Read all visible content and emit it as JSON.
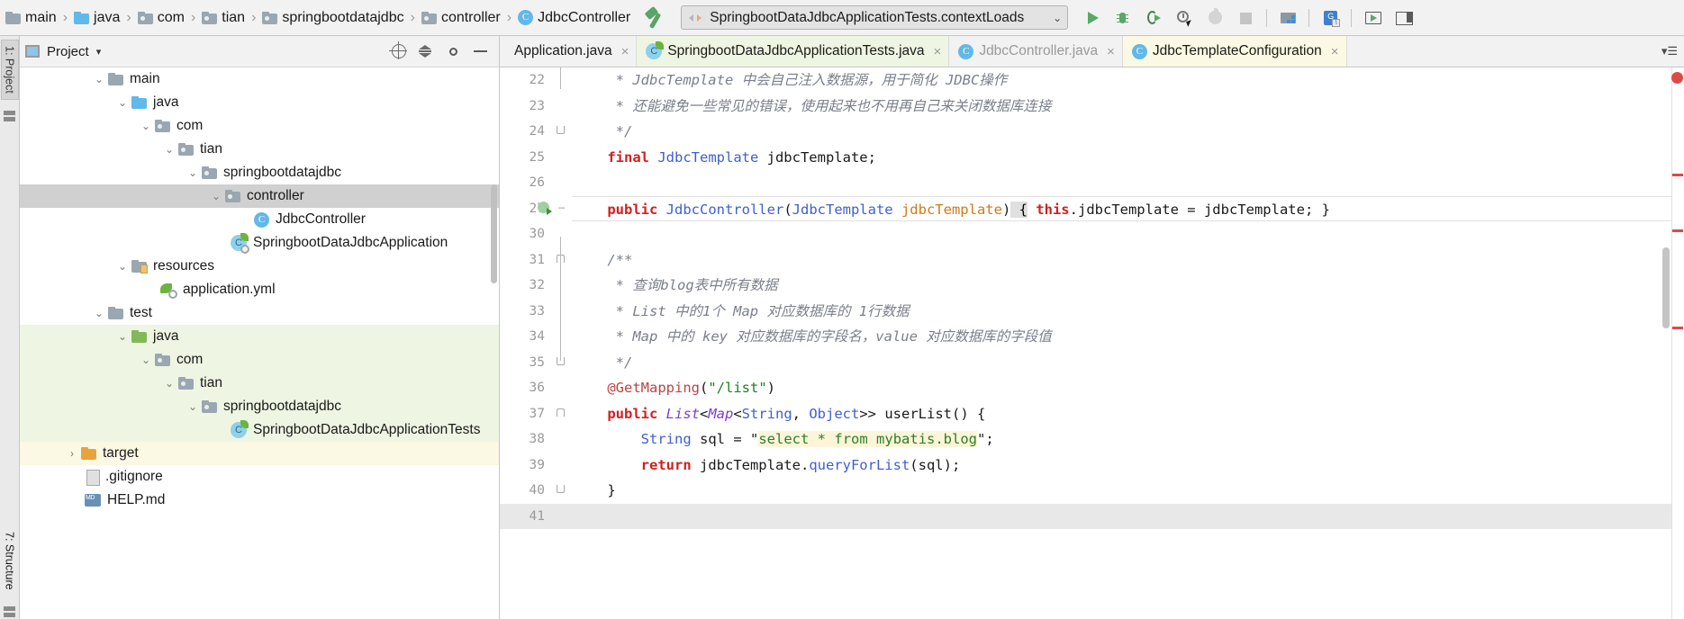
{
  "navbar": {
    "breadcrumb": [
      {
        "label": "main",
        "icon": "folder-icon"
      },
      {
        "label": "java",
        "icon": "folder-blue-icon"
      },
      {
        "label": "com",
        "icon": "package-icon"
      },
      {
        "label": "tian",
        "icon": "package-icon"
      },
      {
        "label": "springbootdatajdbc",
        "icon": "package-icon"
      },
      {
        "label": "controller",
        "icon": "package-icon"
      },
      {
        "label": "JdbcController",
        "icon": "java-class-icon"
      }
    ],
    "separator": "›",
    "build_icon": "hammer-icon",
    "run_config": {
      "name": "SpringbootDataJdbcApplicationTests.contextLoads",
      "chevron": "⌄",
      "icon": "run-config-icon"
    },
    "toolbar_buttons": [
      {
        "name": "run-button",
        "icon": "play-icon",
        "tooltip": "Run"
      },
      {
        "name": "debug-button",
        "icon": "bug-icon",
        "tooltip": "Debug"
      },
      {
        "name": "run-with-coverage-button",
        "icon": "coverage-icon",
        "tooltip": "Run with Coverage"
      },
      {
        "name": "profile-button",
        "icon": "profiler-icon",
        "tooltip": "Profile"
      },
      {
        "name": "attach-button",
        "icon": "apple-icon",
        "tooltip": "Attach"
      },
      {
        "name": "stop-button",
        "icon": "stop-icon",
        "tooltip": "Stop"
      },
      {
        "name": "stack-button",
        "icon": "stack-icon",
        "tooltip": "Services"
      },
      {
        "name": "translate-button",
        "icon": "translate-icon",
        "tooltip": "Translate"
      },
      {
        "name": "screen-button",
        "icon": "screen-icon",
        "tooltip": "Presentation"
      },
      {
        "name": "layout-button",
        "icon": "layout-icon",
        "tooltip": "Layout"
      }
    ]
  },
  "left_strip": {
    "tabs": [
      {
        "label": "1: Project",
        "name": "tool-window-project"
      },
      {
        "label": "7: Structure",
        "name": "tool-window-structure"
      }
    ],
    "bottom_icon": "grid-icon"
  },
  "project_panel": {
    "title": "Project",
    "caret": "▾",
    "header_buttons": [
      {
        "name": "select-opened-file-button",
        "icon": "target-icon"
      },
      {
        "name": "collapse-all-button",
        "icon": "collapse-all-icon"
      },
      {
        "name": "settings-button",
        "icon": "gear-icon"
      },
      {
        "name": "hide-button",
        "icon": "minus-icon"
      }
    ],
    "tree": [
      {
        "label": "main",
        "indent": 3,
        "twist": "⌄",
        "icon": "folder-icon",
        "state": "normal"
      },
      {
        "label": "java",
        "indent": 4,
        "twist": "⌄",
        "icon": "folder-blue-icon",
        "state": "normal"
      },
      {
        "label": "com",
        "indent": 5,
        "twist": "⌄",
        "icon": "package-icon",
        "state": "normal"
      },
      {
        "label": "tian",
        "indent": 6,
        "twist": "⌄",
        "icon": "package-icon",
        "state": "normal"
      },
      {
        "label": "springbootdatajdbc",
        "indent": 7,
        "twist": "⌄",
        "icon": "package-icon",
        "state": "normal"
      },
      {
        "label": "controller",
        "indent": 8,
        "twist": "⌄",
        "icon": "package-icon",
        "state": "selected"
      },
      {
        "label": "JdbcController",
        "indent": 10,
        "twist": "",
        "icon": "java-class-icon",
        "state": "normal"
      },
      {
        "label": "SpringbootDataJdbcApplication",
        "indent": 9,
        "twist": "",
        "icon": "spring-boot-icon",
        "state": "normal"
      },
      {
        "label": "resources",
        "indent": 4,
        "twist": "⌄",
        "icon": "resources-folder-icon",
        "state": "normal"
      },
      {
        "label": "application.yml",
        "indent": 6,
        "twist": "",
        "icon": "spring-yaml-icon",
        "state": "normal"
      },
      {
        "label": "test",
        "indent": 3,
        "twist": "⌄",
        "icon": "folder-icon",
        "state": "normal"
      },
      {
        "label": "java",
        "indent": 4,
        "twist": "⌄",
        "icon": "folder-green-icon",
        "state": "test"
      },
      {
        "label": "com",
        "indent": 5,
        "twist": "⌄",
        "icon": "package-icon",
        "state": "test"
      },
      {
        "label": "tian",
        "indent": 6,
        "twist": "⌄",
        "icon": "package-icon",
        "state": "test"
      },
      {
        "label": "springbootdatajdbc",
        "indent": 7,
        "twist": "⌄",
        "icon": "package-icon",
        "state": "test"
      },
      {
        "label": "SpringbootDataJdbcApplicationTests",
        "indent": 9,
        "twist": "",
        "icon": "java-class-icon",
        "state": "test"
      },
      {
        "label": "target",
        "indent": 2,
        "twist": "›",
        "icon": "folder-orange-icon",
        "state": "target"
      },
      {
        "label": ".gitignore",
        "indent": 3,
        "twist": "",
        "icon": "gitignore-icon",
        "state": "normal"
      },
      {
        "label": "HELP.md",
        "indent": 3,
        "twist": "",
        "icon": "markdown-icon",
        "state": "normal"
      }
    ]
  },
  "editor": {
    "tabs": [
      {
        "label": "Application.java",
        "icon": "none",
        "state": "inactive",
        "close": "×"
      },
      {
        "label": "SpringbootDataJdbcApplicationTests.java",
        "icon": "spring-boot-icon",
        "state": "active-green",
        "close": "×"
      },
      {
        "label": "JdbcController.java",
        "icon": "java-class-icon",
        "state": "inactive-muted",
        "close": "×"
      },
      {
        "label": "JdbcTemplateConfiguration",
        "icon": "java-class-icon",
        "state": "active-yellow",
        "close": "×"
      }
    ],
    "tab_overflow": "▾☰",
    "lines": [
      {
        "num": "22",
        "fold": "none",
        "runmark": false,
        "text": "     * JdbcTemplate 中会自己注入数据源，用于简化 JDBC操作",
        "style": "comment"
      },
      {
        "num": "23",
        "fold": "none",
        "runmark": false,
        "text": "     * 还能避免一些常见的错误，使用起来也不用再自己来关闭数据库连接",
        "style": "comment"
      },
      {
        "num": "24",
        "fold": "end",
        "runmark": false,
        "text": "     */",
        "style": "comment"
      },
      {
        "num": "25",
        "fold": "none",
        "runmark": false,
        "text": "    final JdbcTemplate jdbcTemplate;",
        "style": "code-field"
      },
      {
        "num": "26",
        "fold": "none",
        "runmark": false,
        "text": "",
        "style": "blank"
      },
      {
        "num": "27",
        "fold": "collapsed",
        "runmark": true,
        "text": "    public JdbcController(JdbcTemplate jdbcTemplate) { this.jdbcTemplate = jdbcTemplate; }",
        "style": "code-ctor"
      },
      {
        "num": "30",
        "fold": "none",
        "runmark": false,
        "text": "",
        "style": "blank"
      },
      {
        "num": "31",
        "fold": "start",
        "runmark": false,
        "text": "    /**",
        "style": "comment"
      },
      {
        "num": "32",
        "fold": "none",
        "runmark": false,
        "text": "     * 查询blog表中所有数据",
        "style": "comment"
      },
      {
        "num": "33",
        "fold": "none",
        "runmark": false,
        "text": "     * List 中的1个 Map 对应数据库的 1行数据",
        "style": "comment"
      },
      {
        "num": "34",
        "fold": "none",
        "runmark": false,
        "text": "     * Map 中的 key 对应数据库的字段名，value 对应数据库的字段值",
        "style": "comment"
      },
      {
        "num": "35",
        "fold": "end",
        "runmark": false,
        "text": "     */",
        "style": "comment"
      },
      {
        "num": "36",
        "fold": "none",
        "runmark": false,
        "text": "    @GetMapping(\"/list\")",
        "style": "annotation"
      },
      {
        "num": "37",
        "fold": "start",
        "runmark": false,
        "text": "    public List<Map<String, Object>> userList() {",
        "style": "code-method"
      },
      {
        "num": "38",
        "fold": "none",
        "runmark": false,
        "text": "        String sql = \"select * from mybatis.blog\";",
        "style": "code-sql"
      },
      {
        "num": "39",
        "fold": "none",
        "runmark": false,
        "text": "        return jdbcTemplate.queryForList(sql);",
        "style": "code-return"
      },
      {
        "num": "40",
        "fold": "end",
        "runmark": false,
        "text": "    }",
        "style": "code-brace"
      },
      {
        "num": "41",
        "fold": "none",
        "runmark": false,
        "text": "",
        "style": "current-blank"
      }
    ],
    "marker_error_count": "",
    "colors": {
      "keyword": "#d02020",
      "type": "#7a3fcf",
      "comment": "#7a7f8a",
      "string": "#1a7f1a",
      "annotation": "#bb4444",
      "field": "#5a1a8a",
      "parameter": "#d07a1a",
      "selection": "#d0d0d0",
      "test_bg": "#eef5e2",
      "target_bg": "#fbf8e3"
    }
  }
}
